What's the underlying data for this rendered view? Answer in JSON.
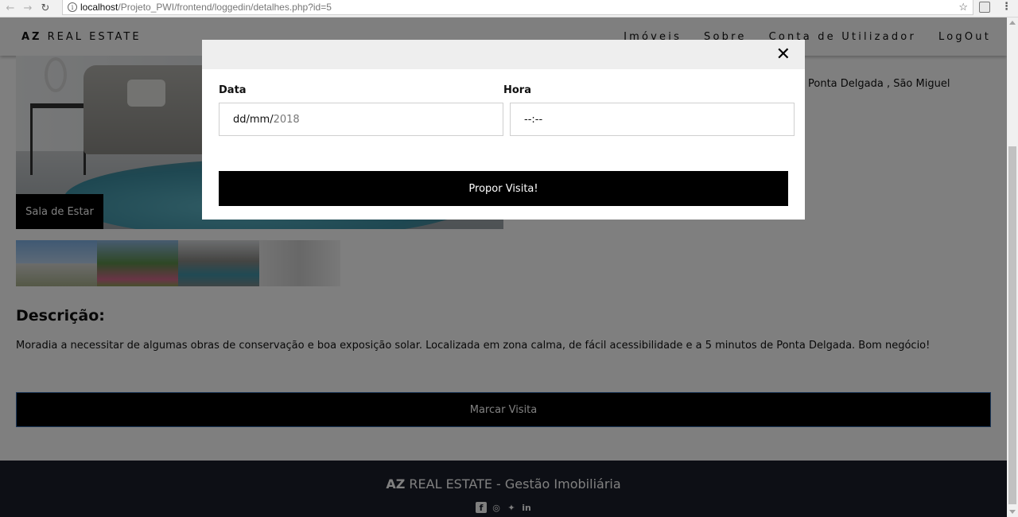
{
  "browser": {
    "url_host": "localhost",
    "url_path": "/Projeto_PWI/frontend/loggedin/detalhes.php?id=5"
  },
  "navbar": {
    "brand_bold": "AZ",
    "brand_rest": " REAL ESTATE",
    "links": [
      "Imóveis",
      "Sobre",
      "Conta de Utilizador",
      "LogOut"
    ]
  },
  "property": {
    "image_caption": "Sala de Estar",
    "location": "Ponta Delgada , São Miguel",
    "description_title": "Descrição:",
    "description_text": "Moradia a necessitar de algumas obras de conservação e boa exposição solar. Localizada em zona calma, de fácil acessibilidade e a 5 minutos de Ponta Delgada. Bom negócio!",
    "schedule_button": "Marcar Visita"
  },
  "footer": {
    "title_bold": "AZ",
    "title_rest": " REAL ESTATE - Gestão Imobiliária",
    "social_icons": [
      "facebook-icon",
      "instagram-icon",
      "twitter-icon",
      "linkedin-icon"
    ]
  },
  "modal": {
    "close_symbol": "✕",
    "date_label": "Data",
    "date_value_mask": "dd/mm/",
    "date_value_year": "2018",
    "time_label": "Hora",
    "time_value": "--:--",
    "submit_label": "Propor Visita!"
  },
  "colors": {
    "overlay": "rgba(0,0,0,0.5)",
    "button": "#000000",
    "footer": "#1a1f2a",
    "button_border": "#3b6fb0"
  }
}
